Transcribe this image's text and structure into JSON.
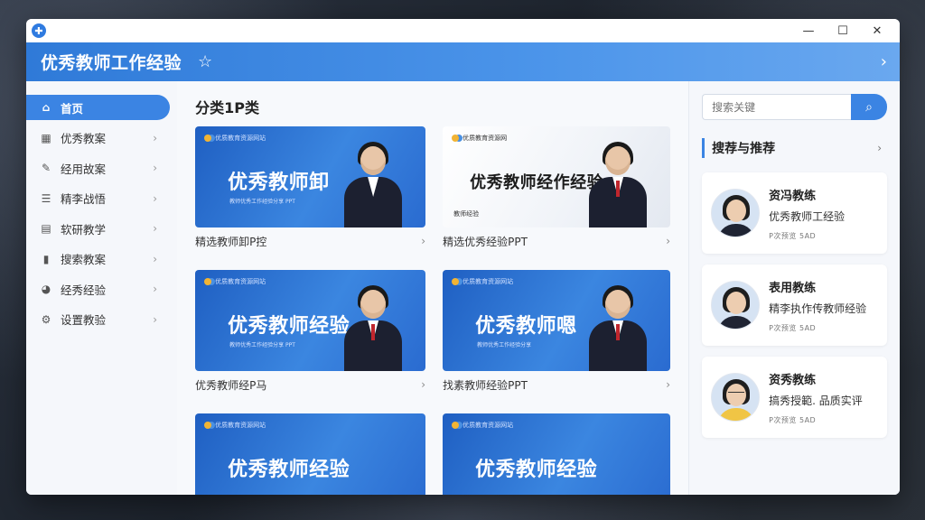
{
  "header": {
    "title": "优秀教师工作经验"
  },
  "sidebar": {
    "items": [
      {
        "label": "首页",
        "icon": "home-icon"
      },
      {
        "label": "优秀教案",
        "icon": "grid-icon"
      },
      {
        "label": "经用故案",
        "icon": "pin-icon"
      },
      {
        "label": "精李战悟",
        "icon": "list-icon"
      },
      {
        "label": "软研教学",
        "icon": "doc-icon"
      },
      {
        "label": "搜索教案",
        "icon": "book-icon"
      },
      {
        "label": "经秀经验",
        "icon": "pie-icon"
      },
      {
        "label": "设置教验",
        "icon": "gear-icon"
      }
    ]
  },
  "main": {
    "section_title": "分类1P类",
    "cards": [
      {
        "heading": "优秀教师卸",
        "top": "优质教育资源网站",
        "sub": "教师优秀工作经验分享 PPT",
        "caption": "精选教师卸P控",
        "style": "blue"
      },
      {
        "heading": "优秀教师经作经验",
        "top": "优质教育资源网",
        "sub": "",
        "foot": "教师经验",
        "caption": "精选优秀经验PPT",
        "style": "light"
      },
      {
        "heading": "优秀教师经验",
        "top": "优质教育资源网站",
        "sub": "教师优秀工作经验分享 PPT",
        "caption": "优秀教师经P马",
        "style": "blue"
      },
      {
        "heading": "优秀教师嗯",
        "top": "优质教育资源网站",
        "sub": "教师优秀工作经验分享",
        "caption": "找素教师经验PPT",
        "style": "blue"
      },
      {
        "heading": "优秀教师经验",
        "top": "优质教育资源网站",
        "sub": "",
        "caption": "",
        "style": "blue"
      },
      {
        "heading": "优秀教师经验",
        "top": "优质教育资源网站",
        "sub": "",
        "caption": "",
        "style": "blue"
      }
    ]
  },
  "right": {
    "search_placeholder": "搜索关键",
    "panel_title": "搜荐与推荐",
    "recs": [
      {
        "name": "资冯教练",
        "desc": "优秀教师工经验",
        "meta": "P次预览 5AD"
      },
      {
        "name": "表用教练",
        "desc": "精李执作传教师经验",
        "meta": "P次预览 5AD"
      },
      {
        "name": "资秀教练",
        "desc": "搞秀授範. 品质实评",
        "meta": "P次预览 5AD"
      }
    ]
  }
}
